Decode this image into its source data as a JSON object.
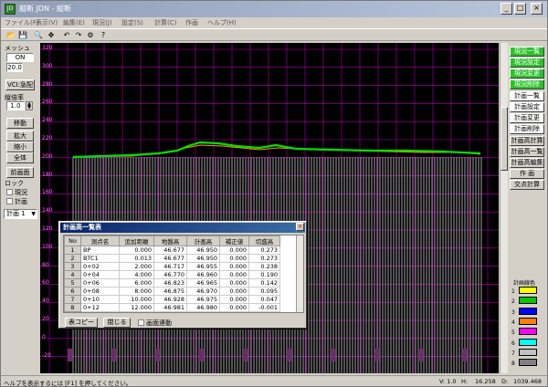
{
  "window": {
    "title": "縦断 JDN - 縦断",
    "app_icon": "JD"
  },
  "menu": [
    "ファイル(F)",
    "表示(V)",
    "編集(E)",
    "現況(J)",
    "設定(S)",
    "計算(C)",
    "作画",
    "ヘルプ(H)"
  ],
  "toolbar": [
    {
      "icon": "folder-icon",
      "glyph": "📂"
    },
    {
      "icon": "save-icon",
      "glyph": "💾"
    },
    {
      "icon": "zoom-icon",
      "glyph": "🔍"
    },
    {
      "icon": "pan-icon",
      "glyph": "✥"
    },
    {
      "icon": "undo-icon",
      "glyph": "↶"
    },
    {
      "icon": "redo-icon",
      "glyph": "↷"
    },
    {
      "icon": "settings-icon",
      "glyph": "⚙"
    },
    {
      "icon": "help-icon",
      "glyph": "?"
    }
  ],
  "left": {
    "mesh_label": "メッシュ",
    "mesh_toggle": "ON",
    "mesh_value": "20.0",
    "vci_button": "VCI:急配",
    "scale_label": "縦倍率",
    "scale_value": "1.0",
    "move_button": "移動",
    "zoom_in_button": "拡大",
    "zoom_out_button": "縮小",
    "fit_button": "全体",
    "prev_screen_button": "前画面",
    "lock_label": "ロック",
    "lock_current": "現況",
    "lock_plan": "計画",
    "plan_select": "計画 1"
  },
  "y_ticks": [
    "320",
    "300",
    "280",
    "260",
    "240",
    "220",
    "200",
    "180",
    "160",
    "140",
    "120",
    "100",
    "80",
    "60",
    "40",
    "20",
    "0",
    "-20"
  ],
  "right": {
    "buttons_green": [
      "現況一覧",
      "現況設定",
      "現況変更",
      "現況削除"
    ],
    "buttons_white": [
      "計画一覧",
      "計画設定",
      "計画変更",
      "計画削除"
    ],
    "buttons_plain": [
      "計画高計算",
      "計画高一覧",
      "計画高編集",
      "作 画",
      "交点計算"
    ],
    "legend_title": "計画線色",
    "legend": [
      {
        "n": "1",
        "color": "#ffff00"
      },
      {
        "n": "2",
        "color": "#00c800"
      },
      {
        "n": "3",
        "color": "#0000ff"
      },
      {
        "n": "4",
        "color": "#ff8000"
      },
      {
        "n": "5",
        "color": "#ff00ff"
      },
      {
        "n": "6",
        "color": "#00ffff"
      },
      {
        "n": "7",
        "color": "#c0c0c0"
      },
      {
        "n": "8",
        "color": "#808080"
      }
    ]
  },
  "dialog": {
    "title": "計画高一覧表",
    "columns": [
      "No",
      "測点名",
      "追加距離",
      "地盤高",
      "計画高",
      "補正値",
      "切盛高"
    ],
    "rows": [
      [
        "1",
        "BP",
        "0.000",
        "46.677",
        "46.950",
        "0.000",
        "0.273"
      ],
      [
        "2",
        "BTC1",
        "0.013",
        "46.677",
        "46.950",
        "0.000",
        "0.273"
      ],
      [
        "3",
        "0+02",
        "2.000",
        "46.717",
        "46.955",
        "0.000",
        "0.238"
      ],
      [
        "4",
        "0+04",
        "4.000",
        "46.770",
        "46.960",
        "0.000",
        "0.190"
      ],
      [
        "5",
        "0+06",
        "6.000",
        "46.823",
        "46.965",
        "0.000",
        "0.142"
      ],
      [
        "6",
        "0+08",
        "8.000",
        "46.875",
        "46.970",
        "0.000",
        "0.095"
      ],
      [
        "7",
        "0+10",
        "10.000",
        "46.928",
        "46.975",
        "0.000",
        "0.047"
      ],
      [
        "8",
        "0+12",
        "12.000",
        "46.981",
        "46.980",
        "0.000",
        "-0.001"
      ]
    ],
    "copy_button": "表コピー",
    "close_button": "閉じる",
    "sync_checkbox": "画面連動"
  },
  "status": {
    "help_text": "ヘルプを表示するには [F1] を押してください。",
    "version": "V: 1.0",
    "h_label": "H:",
    "h_value": "16.258",
    "d_label": "D:",
    "d_value": "1039.468"
  }
}
